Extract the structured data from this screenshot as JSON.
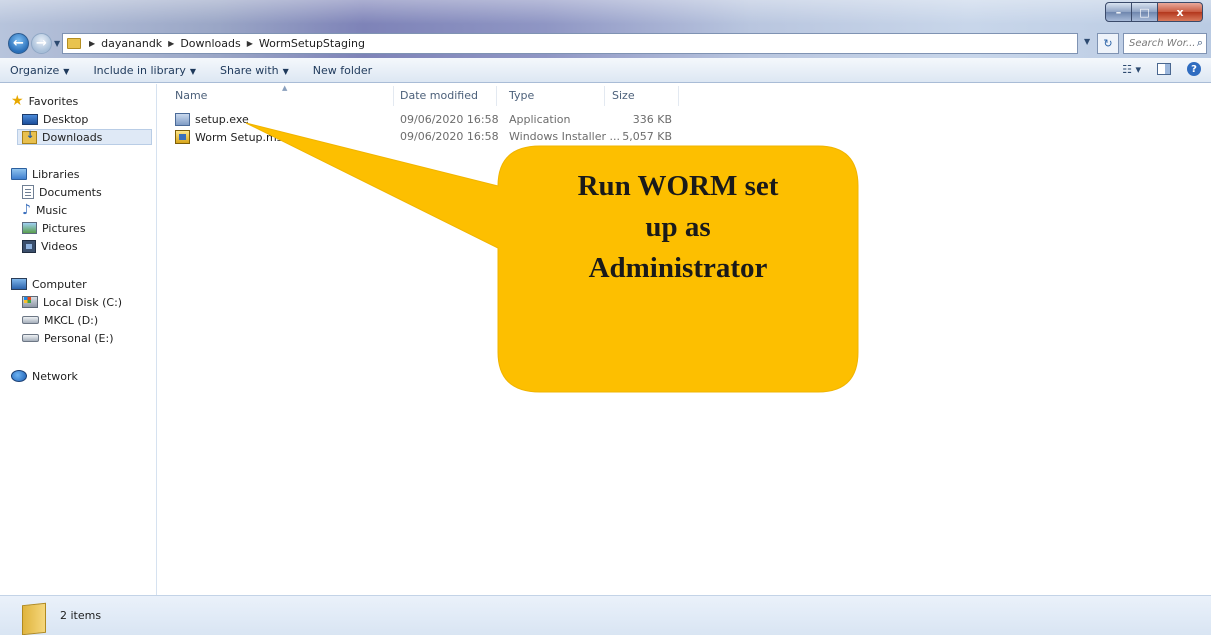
{
  "window": {
    "controls": {
      "minimize": "–",
      "maximize": "□",
      "close": "x"
    }
  },
  "address": {
    "breadcrumbs": [
      "dayanandk",
      "Downloads",
      "WormSetupStaging"
    ],
    "search_placeholder": "Search Wor..."
  },
  "toolbar": {
    "organize": "Organize",
    "include_in_library": "Include in library",
    "share_with": "Share with",
    "new_folder": "New folder"
  },
  "sidebar": {
    "favorites": "Favorites",
    "desktop": "Desktop",
    "downloads": "Downloads",
    "libraries": "Libraries",
    "documents": "Documents",
    "music": "Music",
    "pictures": "Pictures",
    "videos": "Videos",
    "computer": "Computer",
    "local_disk": "Local Disk (C:)",
    "mkcl": "MKCL (D:)",
    "personal": "Personal (E:)",
    "network": "Network"
  },
  "columns": {
    "name": "Name",
    "date_modified": "Date modified",
    "type": "Type",
    "size": "Size"
  },
  "files": [
    {
      "name": "setup.exe",
      "date": "09/06/2020 16:58",
      "type": "Application",
      "size": "336 KB",
      "icon": "application-icon"
    },
    {
      "name": "Worm Setup.msi",
      "date": "09/06/2020 16:58",
      "type": "Windows Installer ...",
      "size": "5,057 KB",
      "icon": "installer-icon"
    }
  ],
  "status": {
    "item_count": "2 items"
  },
  "callout": {
    "line1": "Run WORM set",
    "line2": "up as",
    "line3": "Administrator",
    "color": "#fdbf00"
  }
}
